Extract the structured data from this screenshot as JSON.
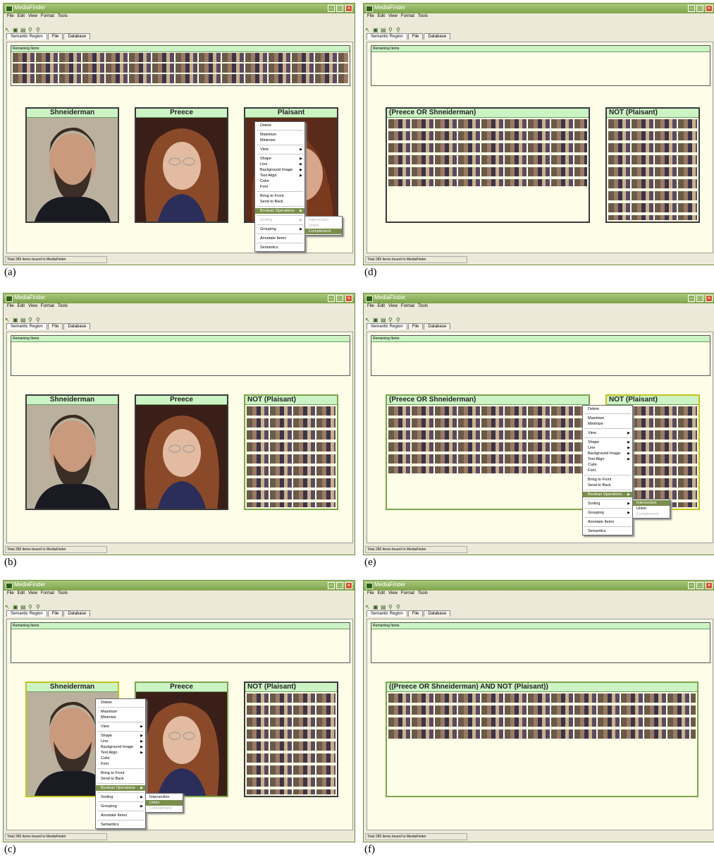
{
  "common": {
    "window_title": "MediaFinder",
    "menu": [
      "File",
      "Edit",
      "View",
      "Format",
      "Tools"
    ],
    "tabs": [
      "Semantic Region",
      "File",
      "Database"
    ],
    "remaining_label": "Remaining Items",
    "status_text": "Total 283 items bound to MediaFinder",
    "context_menu": {
      "delete": "Delete",
      "maximize": "Maximize",
      "minimize": "Minimize",
      "view": "View",
      "shape": "Shape",
      "line": "Line",
      "background_image": "Background Image",
      "text_align": "Text Align",
      "color": "Color",
      "font": "Font",
      "bring_to_front": "Bring to Front",
      "send_to_back": "Send to Back",
      "boolean_operations": "Boolean Operations",
      "sorting": "Sorting",
      "grouping": "Grouping",
      "annotate_items": "Annotate Items",
      "semantics": "Semantics"
    },
    "submenu": {
      "intersection": "Intersection",
      "union": "Union",
      "complement": "Complement"
    }
  },
  "regions": {
    "shneiderman": "Shneiderman",
    "preece": "Preece",
    "plaisant": "Plaisant",
    "not_plaisant": "NOT (Plaisant)",
    "preece_or_shneiderman": "(Preece OR Shneiderman)",
    "final_query": "((Preece OR Shneiderman) AND NOT (Plaisant))"
  },
  "captions": [
    "(a)",
    "(b)",
    "(c)",
    "(d)",
    "(e)",
    "(f)"
  ],
  "colors": {
    "header_green": "#ccf3c4",
    "canvas_yellow": "#fefde8",
    "selection_yellow": "#c3c41a",
    "menu_highlight": "#7a8f4c"
  }
}
